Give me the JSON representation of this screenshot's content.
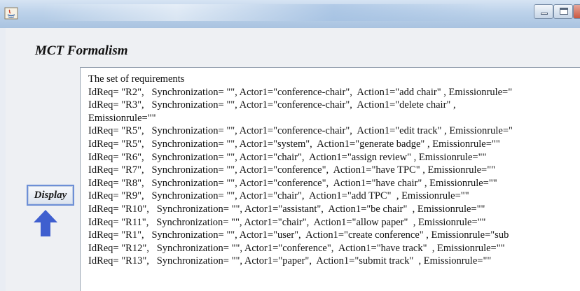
{
  "window": {
    "minimize_label": "",
    "maximize_label": ""
  },
  "form": {
    "title": "MCT Formalism",
    "display_button": "Display"
  },
  "requirements": {
    "lines": [
      "The set of requirements",
      "IdReq= \"R2\",   Synchronization= \"\", Actor1=\"conference-chair\",  Action1=\"add chair\" , Emissionrule=\"",
      "IdReq= \"R3\",   Synchronization= \"\", Actor1=\"conference-chair\",  Action1=\"delete chair\" ,",
      "Emissionrule=\"\"",
      "IdReq= \"R5\",   Synchronization= \"\", Actor1=\"conference-chair\",  Action1=\"edit track\" , Emissionrule=\"",
      "IdReq= \"R5\",   Synchronization= \"\", Actor1=\"system\",  Action1=\"generate badge\" , Emissionrule=\"\"",
      "IdReq= \"R6\",   Synchronization= \"\", Actor1=\"chair\",  Action1=\"assign review\" , Emissionrule=\"\"",
      "IdReq= \"R7\",   Synchronization= \"\", Actor1=\"conference\",  Action1=\"have TPC\" , Emissionrule=\"\"",
      "IdReq= \"R8\",   Synchronization= \"\", Actor1=\"conference\",  Action1=\"have chair\" , Emissionrule=\"\"",
      "IdReq= \"R9\",   Synchronization= \"\", Actor1=\"chair\",  Action1=\"add TPC\"  , Emissionrule=\"\"",
      "IdReq= \"R10\",   Synchronization= \"\", Actor1=\"assistant\",  Action1=\"be chair\"  , Emissionrule=\"\"",
      "IdReq= \"R11\",   Synchronization= \"\", Actor1=\"chair\",  Action1=\"allow paper\"  , Emissionrule=\"\"",
      "IdReq= \"R1\",   Synchronization= \"\", Actor1=\"user\",  Action1=\"create conference\" , Emissionrule=\"sub",
      "IdReq= \"R12\",   Synchronization= \"\", Actor1=\"conference\",  Action1=\"have track\"  , Emissionrule=\"\"",
      "IdReq= \"R13\",   Synchronization= \"\", Actor1=\"paper\",  Action1=\"submit track\"  , Emissionrule=\"\""
    ]
  },
  "colors": {
    "arrow": "#3f5fcf",
    "button_border": "#6d8fd6"
  }
}
